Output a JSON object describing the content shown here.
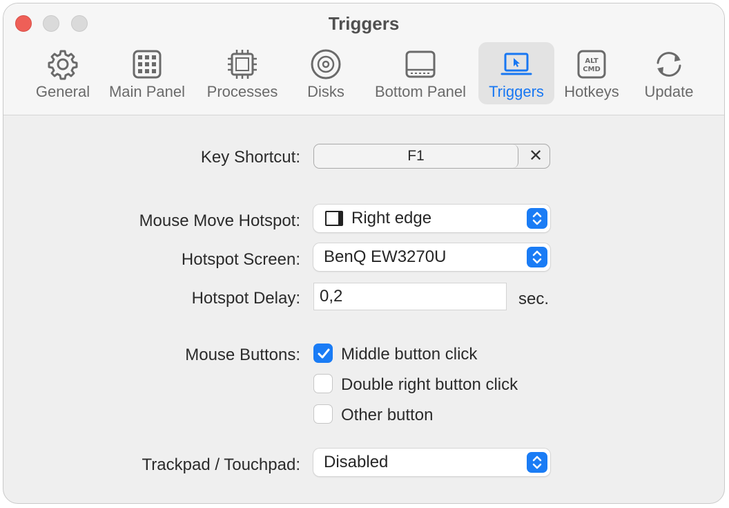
{
  "window": {
    "title": "Triggers"
  },
  "toolbar": {
    "items": [
      {
        "label": "General",
        "icon": "gear-icon",
        "active": false
      },
      {
        "label": "Main Panel",
        "icon": "grid-icon",
        "active": false
      },
      {
        "label": "Processes",
        "icon": "cpu-chip-icon",
        "active": false
      },
      {
        "label": "Disks",
        "icon": "disk-icon",
        "active": false
      },
      {
        "label": "Bottom Panel",
        "icon": "bottom-panel-icon",
        "active": false
      },
      {
        "label": "Triggers",
        "icon": "laptop-cursor-icon",
        "active": true
      },
      {
        "label": "Hotkeys",
        "icon": "alt-cmd-key-icon",
        "active": false
      },
      {
        "label": "Update",
        "icon": "refresh-icon",
        "active": false
      }
    ],
    "accent_color": "#1877f2"
  },
  "form": {
    "key_shortcut": {
      "label": "Key Shortcut:",
      "value": "F1",
      "clear_symbol": "✕"
    },
    "mouse_move_hotspot": {
      "label": "Mouse Move Hotspot:",
      "value": "Right edge",
      "icon": "right-edge-icon"
    },
    "hotspot_screen": {
      "label": "Hotspot Screen:",
      "value": "BenQ EW3270U"
    },
    "hotspot_delay": {
      "label": "Hotspot Delay:",
      "value": "0,2",
      "unit": "sec."
    },
    "mouse_buttons": {
      "label": "Mouse Buttons:",
      "options": [
        {
          "label": "Middle button click",
          "checked": true
        },
        {
          "label": "Double right button click",
          "checked": false
        },
        {
          "label": "Other button",
          "checked": false
        }
      ]
    },
    "trackpad": {
      "label": "Trackpad / Touchpad:",
      "value": "Disabled"
    }
  }
}
